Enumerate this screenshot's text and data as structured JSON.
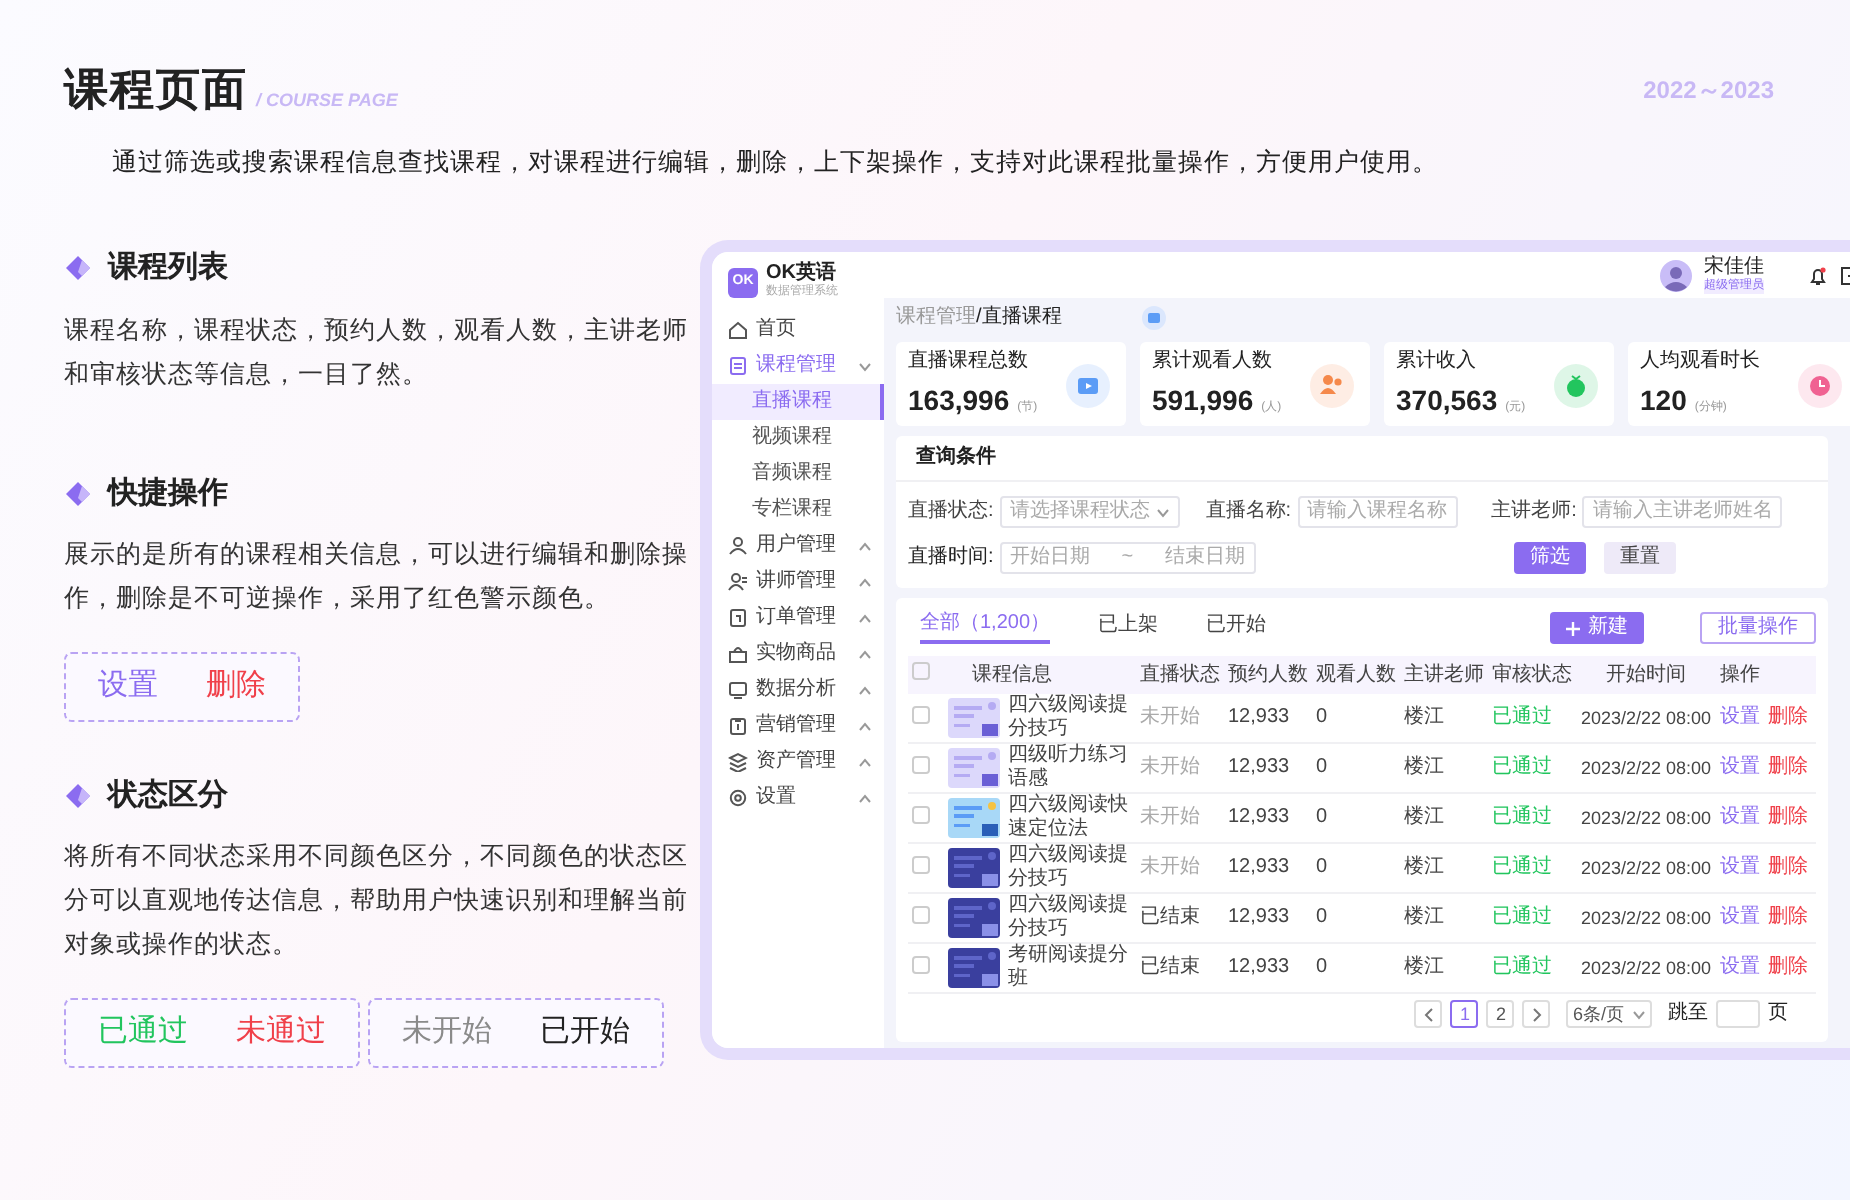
{
  "page": {
    "title": "课程页面",
    "subtitle": "/ COURSE PAGE",
    "years": "2022～2023",
    "intro": "通过筛选或搜索课程信息查找课程，对课程进行编辑，删除，上下架操作，支持对此课程批量操作，方便用户使用。"
  },
  "sections": [
    {
      "kind": "text",
      "title": "课程列表",
      "text": "课程名称，课程状态，预约人数，观看人数，主讲老师和审核状态等信息，一目了然。"
    },
    {
      "kind": "samples",
      "title": "快捷操作",
      "text": "展示的是所有的课程相关信息，可以进行编辑和删除操作，删除是不可逆操作，采用了红色警示颜色。",
      "groups": [
        [
          {
            "label": "设置",
            "color": "#8b6cf0"
          },
          {
            "label": "删除",
            "color": "#f0404a"
          }
        ]
      ]
    },
    {
      "kind": "samples",
      "title": "状态区分",
      "text": "将所有不同状态采用不同颜色区分，不同颜色的状态区分可以直观地传达信息，帮助用户快速识别和理解当前对象或操作的状态。",
      "groups": [
        [
          {
            "label": "已通过",
            "color": "#22c55e"
          },
          {
            "label": "未通过",
            "color": "#f0404a"
          }
        ],
        [
          {
            "label": "未开始",
            "color": "#8a8a8a"
          },
          {
            "label": "已开始",
            "color": "#222222"
          }
        ]
      ]
    }
  ],
  "app": {
    "brand": {
      "logo": "OK",
      "name": "OK英语",
      "subtitle": "数据管理系统"
    },
    "user": {
      "name": "宋佳佳",
      "role": "超级管理员"
    },
    "nav": [
      {
        "label": "首页",
        "selected": false
      },
      {
        "label": "课程管理",
        "expanded": true,
        "selected": false,
        "children": [
          {
            "label": "直播课程",
            "selected": true
          },
          {
            "label": "视频课程",
            "selected": false
          },
          {
            "label": "音频课程",
            "selected": false
          },
          {
            "label": "专栏课程",
            "selected": false
          }
        ]
      },
      {
        "label": "用户管理",
        "expanded": false,
        "selected": false
      },
      {
        "label": "讲师管理",
        "expanded": false,
        "selected": false
      },
      {
        "label": "订单管理",
        "expanded": false,
        "selected": false
      },
      {
        "label": "实物商品",
        "expanded": false,
        "selected": false
      },
      {
        "label": "数据分析",
        "expanded": false,
        "selected": false
      },
      {
        "label": "营销管理",
        "expanded": false,
        "selected": false
      },
      {
        "label": "资产管理",
        "expanded": false,
        "selected": false
      },
      {
        "label": "设置",
        "expanded": false,
        "selected": false
      }
    ],
    "breadcrumb": {
      "parent": "课程管理",
      "separator": "/",
      "current": "直播课程"
    },
    "stats": [
      {
        "label": "直播课程总数",
        "value": "163,996",
        "unit": "(节)",
        "color": "#5b9cf6"
      },
      {
        "label": "累计观看人数",
        "value": "591,996",
        "unit": "(人)",
        "color": "#f5894b"
      },
      {
        "label": "累计收入",
        "value": "370,563",
        "unit": "(元)",
        "color": "#22c55e"
      },
      {
        "label": "人均观看时长",
        "value": "120",
        "unit": "(分钟)",
        "color": "#f06292"
      }
    ],
    "filter": {
      "title": "查询条件",
      "fields": [
        {
          "label": "直播状态:",
          "kind": "select",
          "placeholder": "请选择课程状态"
        },
        {
          "label": "直播名称:",
          "kind": "input",
          "placeholder": "请输入课程名称"
        },
        {
          "label": "主讲老师:",
          "kind": "input",
          "placeholder": "请输入主讲老师姓名"
        }
      ],
      "date": {
        "label": "直播时间:",
        "start": "开始日期",
        "separator": "~",
        "end": "结束日期"
      },
      "buttons": [
        {
          "label": "筛选",
          "kind": "primary"
        },
        {
          "label": "重置",
          "kind": "secondary"
        }
      ]
    },
    "tabs": [
      {
        "label": "全部（1,200）",
        "selected": true
      },
      {
        "label": "已上架",
        "selected": false
      },
      {
        "label": "已开始",
        "selected": false
      }
    ],
    "toolbar": [
      {
        "label": "新建",
        "kind": "primary"
      },
      {
        "label": "批量操作",
        "kind": "outline"
      }
    ],
    "all_checked": false,
    "columns": [
      "课程信息",
      "直播状态",
      "预约人数",
      "观看人数",
      "主讲老师",
      "审核状态",
      "开始时间",
      "操作"
    ],
    "rows": [
      {
        "checked": false,
        "title": "四六级阅读提分技巧",
        "live": "未开始",
        "ended": false,
        "reserved": "12,933",
        "watched": "0",
        "teacher": "楼江",
        "audit": "已通过",
        "time": "2023/2/22 08:00",
        "actions": [
          "设置",
          "删除"
        ]
      },
      {
        "checked": false,
        "title": "四级听力练习语感",
        "live": "未开始",
        "ended": false,
        "reserved": "12,933",
        "watched": "0",
        "teacher": "楼江",
        "audit": "已通过",
        "time": "2023/2/22 08:00",
        "actions": [
          "设置",
          "删除"
        ]
      },
      {
        "checked": false,
        "title": "四六级阅读快速定位法",
        "live": "未开始",
        "ended": false,
        "reserved": "12,933",
        "watched": "0",
        "teacher": "楼江",
        "audit": "已通过",
        "time": "2023/2/22 08:00",
        "actions": [
          "设置",
          "删除"
        ]
      },
      {
        "checked": false,
        "title": "四六级阅读提分技巧",
        "live": "未开始",
        "ended": false,
        "reserved": "12,933",
        "watched": "0",
        "teacher": "楼江",
        "audit": "已通过",
        "time": "2023/2/22 08:00",
        "actions": [
          "设置",
          "删除"
        ]
      },
      {
        "checked": false,
        "title": "四六级阅读提分技巧",
        "live": "已结束",
        "ended": true,
        "reserved": "12,933",
        "watched": "0",
        "teacher": "楼江",
        "audit": "已通过",
        "time": "2023/2/22 08:00",
        "actions": [
          "设置",
          "删除"
        ]
      },
      {
        "checked": false,
        "title": "考研阅读提分班",
        "live": "已结束",
        "ended": true,
        "reserved": "12,933",
        "watched": "0",
        "teacher": "楼江",
        "audit": "已通过",
        "time": "2023/2/22 08:00",
        "actions": [
          "设置",
          "删除"
        ]
      }
    ],
    "pagination": {
      "pages": [
        {
          "label": "1",
          "selected": true
        },
        {
          "label": "2",
          "selected": false
        }
      ],
      "page_size": "6条/页",
      "jump_label": "跳至",
      "jump_suffix": "页"
    }
  }
}
